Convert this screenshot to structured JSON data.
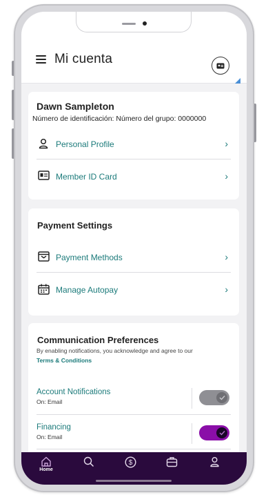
{
  "header": {
    "title": "Mi cuenta"
  },
  "profile_card": {
    "name": "Dawn Sampleton",
    "member_id_text": "Número de identificación: Número del grupo: 0000000",
    "items": [
      {
        "label": "Personal Profile",
        "icon": "person-icon"
      },
      {
        "label": "Member ID Card",
        "icon": "id-card-icon"
      }
    ]
  },
  "payment_card": {
    "title": "Payment Settings",
    "items": [
      {
        "label": "Payment Methods",
        "icon": "wallet-icon"
      },
      {
        "label": "Manage Autopay",
        "icon": "calendar-icon"
      }
    ]
  },
  "communication_card": {
    "title": "Communication Preferences",
    "description": "By enabling notifications, you acknowledge and agree to our",
    "link": "Terms & Conditions",
    "toggles": [
      {
        "label": "Account Notifications",
        "sub": "On: Email",
        "state": "off"
      },
      {
        "label": "Financing",
        "sub": "On: Email",
        "state": "on"
      }
    ]
  },
  "bottom_nav": {
    "items": [
      {
        "label": "Home",
        "icon": "home-icon",
        "active": true
      },
      {
        "label": "",
        "icon": "search-icon"
      },
      {
        "label": "",
        "icon": "dollar-icon"
      },
      {
        "label": "",
        "icon": "briefcase-icon"
      },
      {
        "label": "",
        "icon": "profile-icon"
      }
    ]
  },
  "colors": {
    "accent_teal": "#1b7a7a",
    "nav_background": "#2a0a3d",
    "toggle_on": "#8a0ea8",
    "toggle_off": "#8f8f94"
  }
}
